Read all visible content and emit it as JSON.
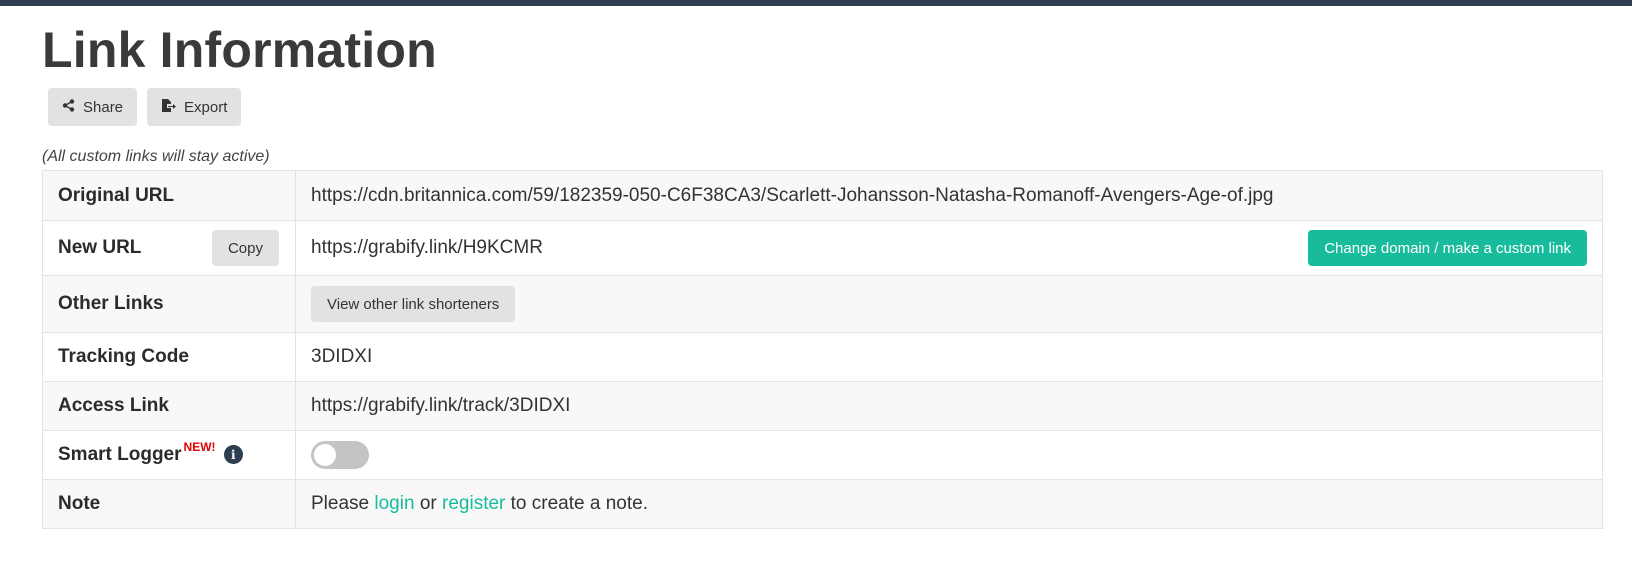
{
  "page": {
    "title": "Link Information",
    "subtitle_note": "(All custom links will stay active)"
  },
  "toolbar": {
    "share_label": "Share",
    "export_label": "Export"
  },
  "rows": {
    "original_url": {
      "label": "Original URL",
      "value": "https://cdn.britannica.com/59/182359-050-C6F38CA3/Scarlett-Johansson-Natasha-Romanoff-Avengers-Age-of.jpg"
    },
    "new_url": {
      "label": "New URL",
      "value": "https://grabify.link/H9KCMR",
      "copy_label": "Copy",
      "custom_label": "Change domain / make a custom link"
    },
    "other_links": {
      "label": "Other Links",
      "button_label": "View other link shorteners"
    },
    "tracking_code": {
      "label": "Tracking Code",
      "value": "3DIDXI"
    },
    "access_link": {
      "label": "Access Link",
      "value": "https://grabify.link/track/3DIDXI"
    },
    "smart_logger": {
      "label": "Smart Logger",
      "badge": "NEW!",
      "enabled": false
    },
    "note": {
      "label": "Note",
      "prefix": "Please",
      "login": "login",
      "or": "or",
      "register": "register",
      "suffix": "to create a note."
    }
  },
  "icons": {
    "share": "share-icon",
    "export": "export-icon",
    "info": "info-icon"
  },
  "colors": {
    "accent": "#18bc9c",
    "header_bar": "#2c3e50",
    "new_badge": "#e00000"
  }
}
